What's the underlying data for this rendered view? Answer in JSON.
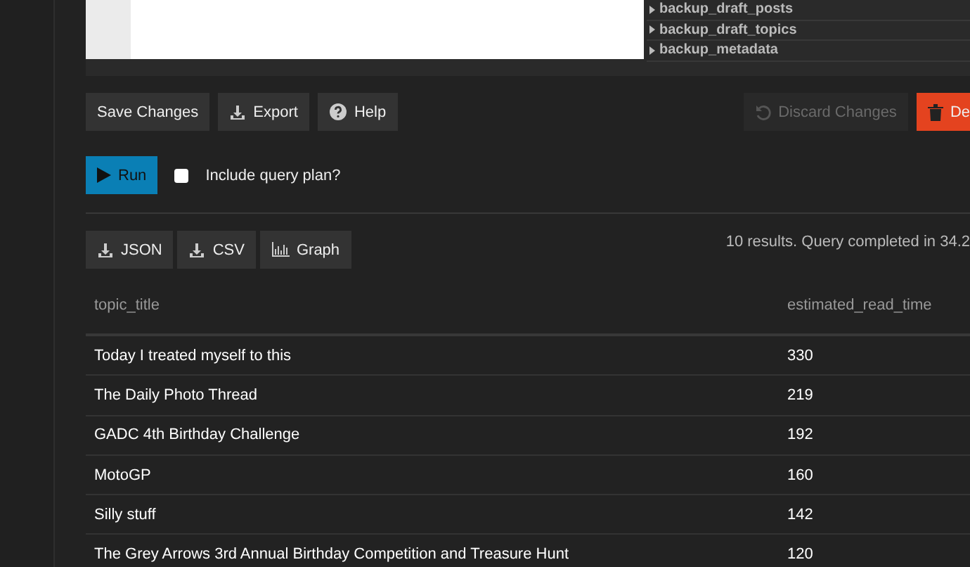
{
  "schema_list": [
    {
      "name": "backup_draft_posts"
    },
    {
      "name": "backup_draft_topics"
    },
    {
      "name": "backup_metadata"
    }
  ],
  "actions": [
    {
      "label": "Save Changes",
      "kind": "plain"
    },
    {
      "label": "Export",
      "kind": "download"
    },
    {
      "label": "Help",
      "kind": "help"
    }
  ],
  "discard_button": {
    "label": "Discard Changes",
    "disabled": true
  },
  "delete_button": {
    "label": "De"
  },
  "run_button": {
    "label": "Run"
  },
  "query_plan": {
    "label": "Include query plan?",
    "checked": false
  },
  "result_buttons": [
    {
      "label": "JSON",
      "kind": "download"
    },
    {
      "label": "CSV",
      "kind": "download"
    },
    {
      "label": "Graph",
      "kind": "chart"
    }
  ],
  "status": "10 results. Query completed in 34.2",
  "table": {
    "columns": [
      "topic_title",
      "estimated_read_time"
    ],
    "rows": [
      [
        "Today I treated myself to this",
        "330"
      ],
      [
        "The Daily Photo Thread",
        "219"
      ],
      [
        "GADC 4th Birthday Challenge",
        "192"
      ],
      [
        "MotoGP",
        "160"
      ],
      [
        "Silly stuff",
        "142"
      ],
      [
        "The Grey Arrows 3rd Annual Birthday Competition and Treasure Hunt",
        "120"
      ]
    ]
  }
}
